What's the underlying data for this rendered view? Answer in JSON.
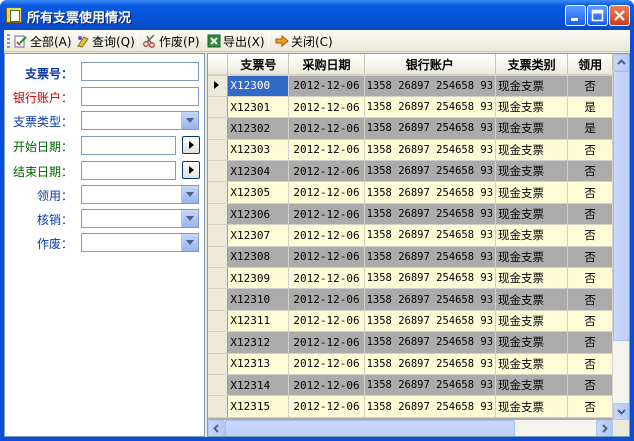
{
  "window": {
    "title": "所有支票使用情况"
  },
  "toolbar": {
    "all": "全部(A)",
    "query": "查询(Q)",
    "void": "作废(P)",
    "export": "导出(X)",
    "close": "关闭(C)"
  },
  "filters": {
    "cheque_no": "支票号：",
    "bank_account": "银行账户：",
    "cheque_type": "支票类型：",
    "start_date": "开始日期：",
    "end_date": "结束日期：",
    "received": "领用：",
    "written_off": "核销：",
    "voided": "作废："
  },
  "grid": {
    "columns": [
      "支票号",
      "采购日期",
      "银行账户",
      "支票类别",
      "领用"
    ],
    "rows": [
      [
        "X12300",
        "2012-12-06",
        "1358 26897 254658 93",
        "现金支票",
        "否"
      ],
      [
        "X12301",
        "2012-12-06",
        "1358 26897 254658 93",
        "现金支票",
        "是"
      ],
      [
        "X12302",
        "2012-12-06",
        "1358 26897 254658 93",
        "现金支票",
        "是"
      ],
      [
        "X12303",
        "2012-12-06",
        "1358 26897 254658 93",
        "现金支票",
        "否"
      ],
      [
        "X12304",
        "2012-12-06",
        "1358 26897 254658 93",
        "现金支票",
        "否"
      ],
      [
        "X12305",
        "2012-12-06",
        "1358 26897 254658 93",
        "现金支票",
        "否"
      ],
      [
        "X12306",
        "2012-12-06",
        "1358 26897 254658 93",
        "现金支票",
        "否"
      ],
      [
        "X12307",
        "2012-12-06",
        "1358 26897 254658 93",
        "现金支票",
        "否"
      ],
      [
        "X12308",
        "2012-12-06",
        "1358 26897 254658 93",
        "现金支票",
        "否"
      ],
      [
        "X12309",
        "2012-12-06",
        "1358 26897 254658 93",
        "现金支票",
        "否"
      ],
      [
        "X12310",
        "2012-12-06",
        "1358 26897 254658 93",
        "现金支票",
        "否"
      ],
      [
        "X12311",
        "2012-12-06",
        "1358 26897 254658 93",
        "现金支票",
        "否"
      ],
      [
        "X12312",
        "2012-12-06",
        "1358 26897 254658 93",
        "现金支票",
        "否"
      ],
      [
        "X12313",
        "2012-12-06",
        "1358 26897 254658 93",
        "现金支票",
        "否"
      ],
      [
        "X12314",
        "2012-12-06",
        "1358 26897 254658 93",
        "现金支票",
        "否"
      ],
      [
        "X12315",
        "2012-12-06",
        "1358 26897 254658 93",
        "现金支票",
        "否"
      ]
    ]
  },
  "colors": {
    "title_bar": "#0653d8",
    "selected_cell": "#3169c6",
    "alt_row": "#fffbd6"
  }
}
